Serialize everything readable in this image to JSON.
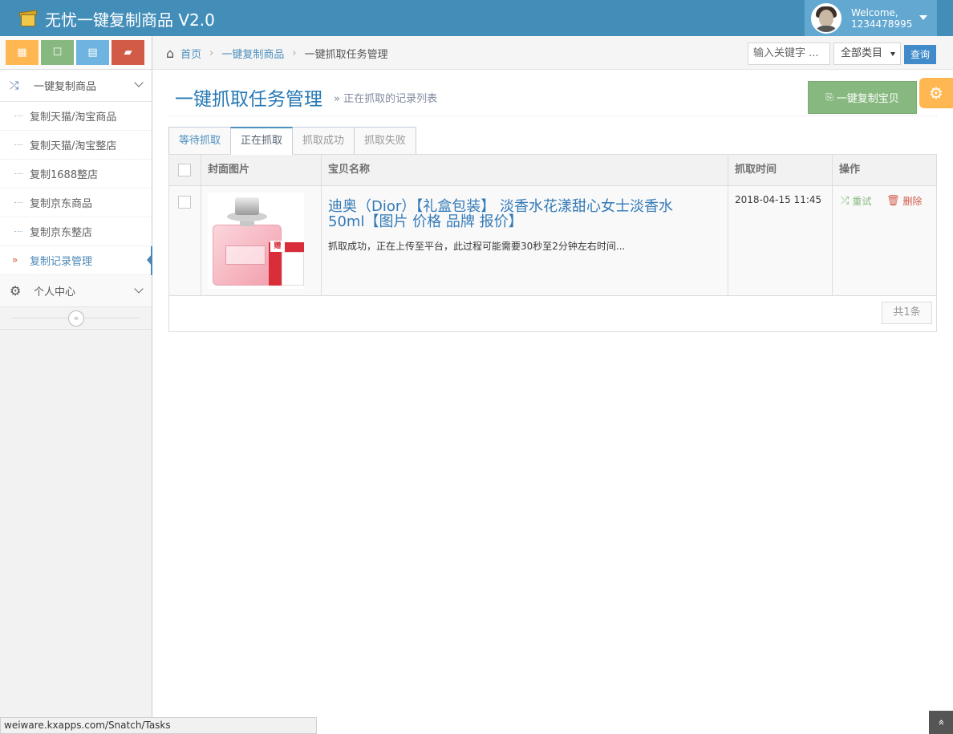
{
  "app": {
    "title": "无忧一键复制商品 V2.0",
    "accent": "#438eb9"
  },
  "user": {
    "welcome": "Welcome,",
    "name": "1234478995"
  },
  "sidebar": {
    "shortcuts": [
      {
        "icon": "calendar-icon",
        "color": "#ffb752"
      },
      {
        "icon": "square-icon",
        "color": "#87b87f"
      },
      {
        "icon": "grid-icon",
        "color": "#6fb3e0"
      },
      {
        "icon": "book-icon",
        "color": "#d15b47"
      }
    ],
    "menu_copy": "一键复制商品",
    "items": [
      {
        "label": "复制天猫/淘宝商品"
      },
      {
        "label": "复制天猫/淘宝整店"
      },
      {
        "label": "复制1688整店"
      },
      {
        "label": "复制京东商品"
      },
      {
        "label": "复制京东整店"
      },
      {
        "label": "复制记录管理"
      }
    ],
    "menu_personal": "个人中心"
  },
  "breadcrumb": {
    "home": "首页",
    "level1": "一键复制商品",
    "level2": "一键抓取任务管理"
  },
  "search": {
    "placeholder": "输入关键字 ...",
    "category": "全部类目",
    "button": "查询"
  },
  "page": {
    "title": "一键抓取任务管理",
    "subtitle": "» 正在抓取的记录列表",
    "copy_button": "一键复制宝贝"
  },
  "tabs": [
    {
      "label": "等待抓取"
    },
    {
      "label": "正在抓取"
    },
    {
      "label": "抓取成功"
    },
    {
      "label": "抓取失败"
    }
  ],
  "table": {
    "columns": [
      "封面图片",
      "宝贝名称",
      "抓取时间",
      "操作"
    ],
    "rows": [
      {
        "name": "迪奥（Dior）【礼盒包装】 淡香水花漾甜心女士淡香水50ml【图片 价格 品牌 报价】",
        "status": "抓取成功，正在上传至平台，此过程可能需要30秒至2分钟左右时间...",
        "time": "2018-04-15 11:45",
        "retry": "重试",
        "delete": "删除"
      }
    ],
    "total": "共1条"
  },
  "image": {
    "gift": "赠"
  },
  "statusbar": {
    "url": "weiware.kxapps.com/Snatch/Tasks"
  }
}
